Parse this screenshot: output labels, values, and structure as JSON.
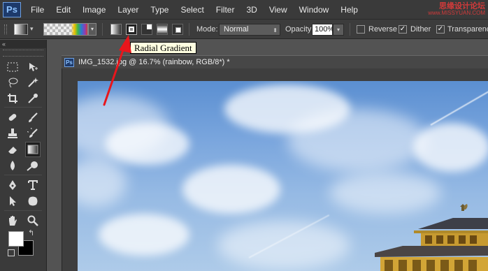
{
  "app": {
    "logo": "Ps",
    "menu": [
      "File",
      "Edit",
      "Image",
      "Layer",
      "Type",
      "Select",
      "Filter",
      "3D",
      "View",
      "Window",
      "Help"
    ],
    "watermark_line1": "思缘设计论坛",
    "watermark_line2": "www.MISSYUAN.COM"
  },
  "options_bar": {
    "gradient_types": [
      "linear",
      "radial",
      "angle",
      "reflected",
      "diamond"
    ],
    "selected_gradient_type": "radial",
    "mode_label": "Mode:",
    "mode_value": "Normal",
    "opacity_label": "Opacity:",
    "opacity_value": "100%",
    "reverse_label": "Reverse",
    "reverse_checked": false,
    "dither_label": "Dither",
    "dither_checked": true,
    "transparency_label": "Transparency",
    "transparency_checked": true
  },
  "tooltip": {
    "text": "Radial Gradient"
  },
  "toolbar": {
    "collapse_glyph": "«",
    "tools": [
      "marquee",
      "move",
      "lasso",
      "magic-wand",
      "crop",
      "eyedropper",
      "healing",
      "brush",
      "stamp",
      "history-brush",
      "eraser",
      "gradient",
      "blur",
      "dodge",
      "pen",
      "type",
      "path-selection",
      "shape",
      "hand",
      "zoom"
    ],
    "active_tool": "gradient",
    "foreground_color": "#ffffff",
    "background_color": "#000000"
  },
  "document": {
    "icon": "Ps",
    "title": "IMG_1532.jpg @ 16.7% (rainbow, RGB/8*) *"
  },
  "colors": {
    "annotation_arrow": "#e8161c",
    "tooltip_bg": "#ffffe1",
    "menubar_bg": "#3a3a3a"
  }
}
